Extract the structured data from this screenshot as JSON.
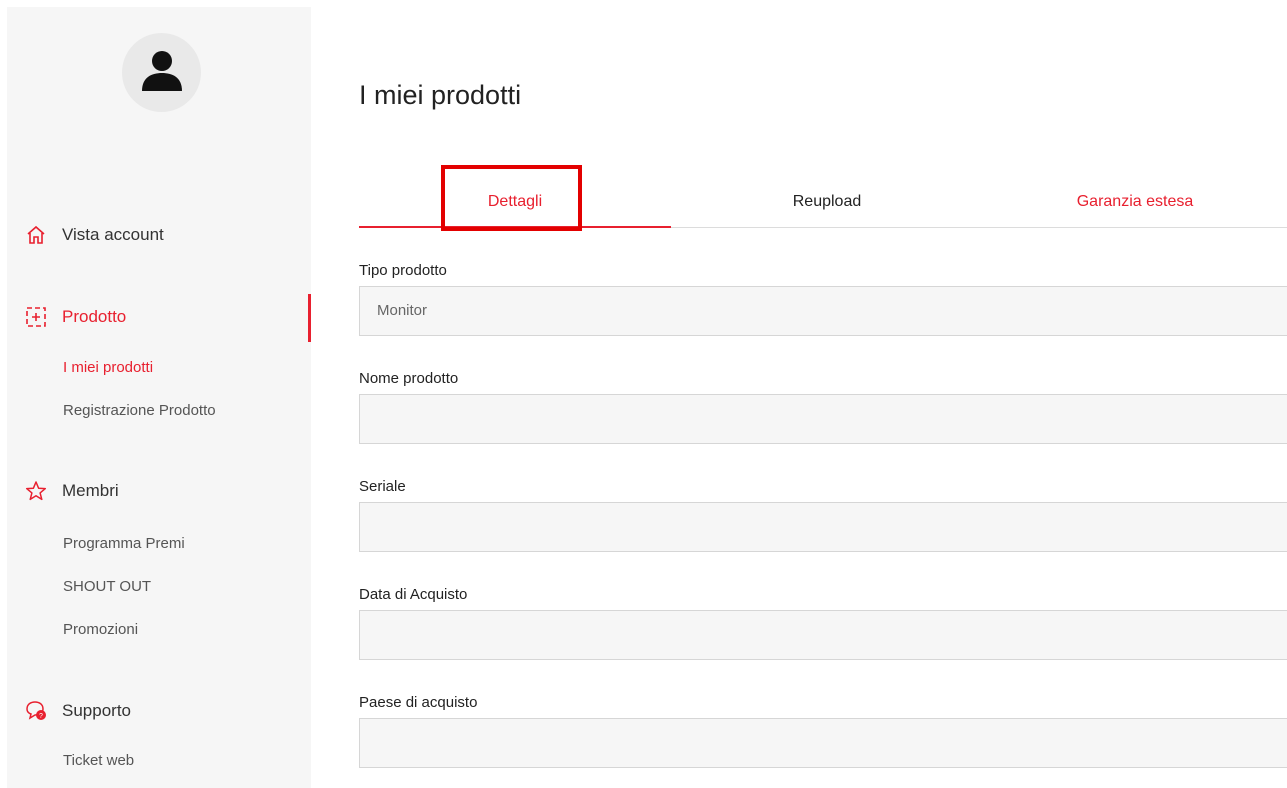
{
  "sidebar": {
    "sections": [
      {
        "label": "Vista account",
        "icon": "home-icon"
      },
      {
        "label": "Prodotto",
        "icon": "product-frame-icon"
      },
      {
        "label": "Membri",
        "icon": "star-icon"
      },
      {
        "label": "Supporto",
        "icon": "support-chat-icon"
      }
    ],
    "prodotto_items": [
      "I miei prodotti",
      "Registrazione Prodotto"
    ],
    "membri_items": [
      "Programma Premi",
      "SHOUT OUT",
      "Promozioni"
    ],
    "supporto_items": [
      "Ticket web"
    ],
    "active_item": "I miei prodotti"
  },
  "main": {
    "title": "I miei prodotti",
    "tabs": [
      "Dettagli",
      "Reupload",
      "Garanzia estesa"
    ],
    "active_tab": "Dettagli",
    "fields": [
      {
        "label": "Tipo prodotto",
        "value": "Monitor"
      },
      {
        "label": "Nome prodotto",
        "value": ""
      },
      {
        "label": "Seriale",
        "value": ""
      },
      {
        "label": "Data di Acquisto",
        "value": ""
      },
      {
        "label": "Paese di acquisto",
        "value": ""
      }
    ]
  },
  "colors": {
    "accent": "#e8202f",
    "highlight": "#e30000",
    "panel": "#f6f6f6"
  }
}
